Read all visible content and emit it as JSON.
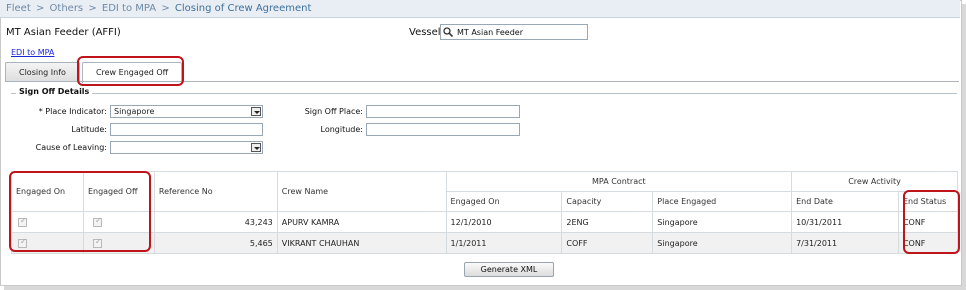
{
  "breadcrumb": {
    "items": [
      "Fleet",
      "Others",
      "EDI to MPA",
      "Closing of Crew Agreement"
    ],
    "separator": ">"
  },
  "vessel_title": "MT Asian Feeder (AFFI)",
  "vessel": {
    "label": "Vessel:",
    "value": "MT Asian Feeder"
  },
  "edi_link": "EDI to MPA",
  "tabs": [
    {
      "label": "Closing Info"
    },
    {
      "label": "Crew Engaged Off"
    }
  ],
  "sign_off": {
    "legend": "Sign Off Details",
    "place_indicator": {
      "label": "* Place Indicator:",
      "value": "Singapore"
    },
    "latitude": {
      "label": "Latitude:",
      "value": ""
    },
    "cause": {
      "label": "Cause of Leaving:",
      "value": ""
    },
    "sign_off_place": {
      "label": "Sign Off Place:",
      "value": ""
    },
    "longitude": {
      "label": "Longitude:",
      "value": ""
    }
  },
  "grid": {
    "headers": {
      "engaged_on": "Engaged On",
      "engaged_off": "Engaged Off",
      "reference_no": "Reference No",
      "crew_name": "Crew Name",
      "mpa_contract": "MPA Contract",
      "crew_activity": "Crew Activity",
      "c_engaged_on": "Engaged On",
      "capacity": "Capacity",
      "place_engaged": "Place Engaged",
      "end_date": "End Date",
      "end_status": "End Status"
    },
    "rows": [
      {
        "engaged_on": true,
        "engaged_off": true,
        "reference_no": "43,243",
        "crew_name": "APURV KAMRA",
        "c_engaged_on": "12/1/2010",
        "capacity": "2ENG",
        "place_engaged": "Singapore",
        "end_date": "10/31/2011",
        "end_status": "CONF"
      },
      {
        "engaged_on": true,
        "engaged_off": true,
        "reference_no": "5,465",
        "crew_name": "VIKRANT CHAUHAN",
        "c_engaged_on": "1/1/2011",
        "capacity": "COFF",
        "place_engaged": "Singapore",
        "end_date": "7/31/2011",
        "end_status": "CONF"
      }
    ]
  },
  "generate_button": "Generate XML",
  "colors": {
    "highlight": "#c0141b",
    "link": "#1a2ad8",
    "breadcrumb_bg": "#e9eef4"
  }
}
